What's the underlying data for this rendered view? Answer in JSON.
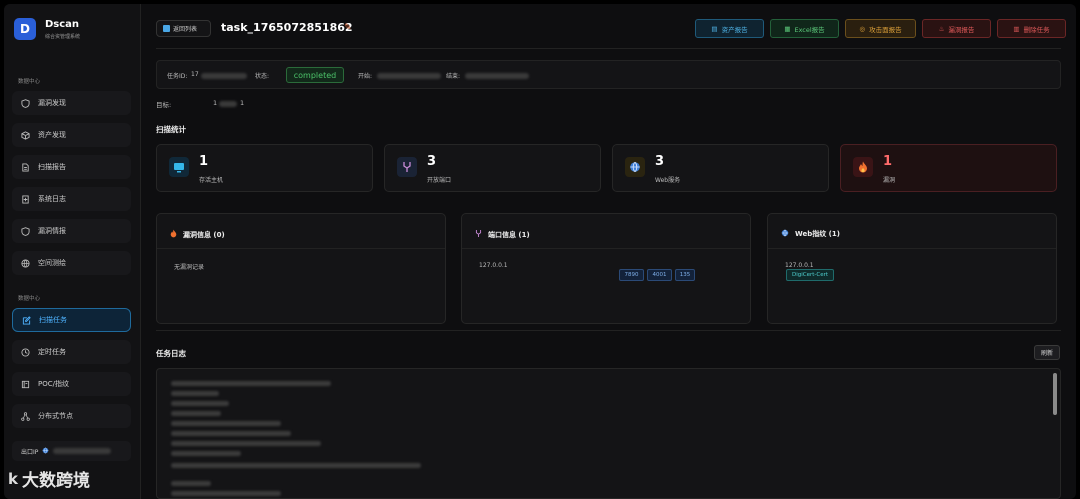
{
  "app": {
    "name": "Dscan",
    "subtitle": "综合资管理系统",
    "logo_letter": "D"
  },
  "sidebar": {
    "section1": "数据中心",
    "items1": [
      {
        "label": "漏洞发现",
        "icon": "shield-icon"
      },
      {
        "label": "资产发现",
        "icon": "cube-icon"
      },
      {
        "label": "扫描报告",
        "icon": "document-icon"
      },
      {
        "label": "系统日志",
        "icon": "log-icon"
      },
      {
        "label": "漏洞情报",
        "icon": "shield-icon"
      },
      {
        "label": "空间测绘",
        "icon": "globe-icon"
      }
    ],
    "section2": "数据中心",
    "items2": [
      {
        "label": "扫描任务",
        "icon": "edit-icon",
        "active": true
      },
      {
        "label": "定时任务",
        "icon": "clock-icon"
      },
      {
        "label": "POC/指纹",
        "icon": "book-icon"
      },
      {
        "label": "分布式节点",
        "icon": "nodes-icon"
      }
    ],
    "exit_ip_label": "出口IP"
  },
  "watermark": {
    "logo": "k",
    "text": "大数跨境"
  },
  "header": {
    "back_label": "返回列表",
    "task_title": "task_1765072851862",
    "buttons": [
      {
        "label": "资产报告",
        "icon": "doc-icon",
        "color": "#4fb3e6"
      },
      {
        "label": "Excel报告",
        "icon": "excel-icon",
        "color": "#5cc97a"
      },
      {
        "label": "攻击面报告",
        "icon": "target-icon",
        "color": "#e0a33a"
      },
      {
        "label": "漏洞报告",
        "icon": "fire-icon",
        "color": "#e35b5b"
      },
      {
        "label": "删除任务",
        "icon": "trash-icon",
        "color": "#e35b5b"
      }
    ]
  },
  "info": {
    "task_id_label": "任务ID:",
    "task_id_value": "17",
    "status_label": "状态:",
    "status_value": "completed",
    "start_label": "开始:",
    "end_label": "结束:"
  },
  "target": {
    "label": "目标:",
    "value_start": "1",
    "value_end": "1"
  },
  "stats_title": "扫描统计",
  "stats": [
    {
      "value": "1",
      "label": "存活主机",
      "icon": "monitor-icon"
    },
    {
      "value": "3",
      "label": "开放端口",
      "icon": "port-icon"
    },
    {
      "value": "3",
      "label": "Web服务",
      "icon": "globe-icon"
    },
    {
      "value": "1",
      "label": "漏洞",
      "icon": "fire-icon"
    }
  ],
  "cards": {
    "vuln": {
      "title": "漏洞信息 (0)",
      "empty": "无漏洞记录"
    },
    "ports": {
      "title": "端口信息 (1)",
      "host": "127.0.0.1",
      "ports": [
        "7890",
        "4001",
        "135"
      ]
    },
    "web": {
      "title": "Web指纹 (1)",
      "host": "127.0.0.1",
      "tags": [
        "DigiCert-Cert"
      ]
    }
  },
  "log": {
    "title": "任务日志",
    "refresh_label": "刷新"
  }
}
